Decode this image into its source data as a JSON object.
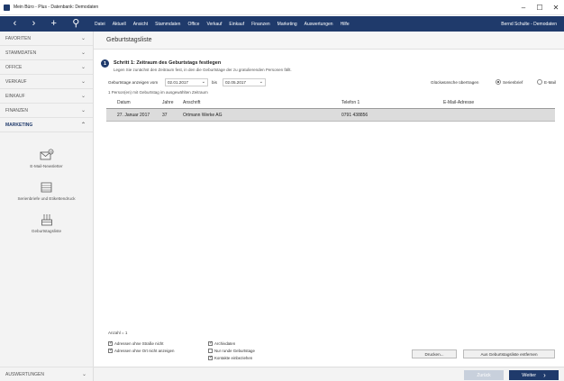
{
  "window": {
    "title": "Mein Büro - Plus - Datenbank: Demodaten",
    "min": "–",
    "max": "☐",
    "close": "✕"
  },
  "nav": {
    "back": "‹",
    "forward": "›",
    "add": "+",
    "search": "⚲"
  },
  "menu": [
    "Datei",
    "Aktuell",
    "Ansicht",
    "Stammdaten",
    "Office",
    "Verkauf",
    "Einkauf",
    "Finanzen",
    "Marketing",
    "Auswertungen",
    "Hilfe"
  ],
  "user": "Bernd Schulte - Demodaten",
  "sidebar": {
    "items": [
      {
        "label": "FAVORITEN",
        "chev": "⌄"
      },
      {
        "label": "STAMMDATEN",
        "chev": "⌄"
      },
      {
        "label": "OFFICE",
        "chev": "⌄"
      },
      {
        "label": "VERKAUF",
        "chev": "⌄"
      },
      {
        "label": "EINKAUF",
        "chev": "⌄"
      },
      {
        "label": "FINANZEN",
        "chev": "⌄"
      },
      {
        "label": "MARKETING",
        "chev": "⌃"
      }
    ],
    "tools": [
      "E-Mail-Newsletter",
      "Serienbriefe und Etikettendruck",
      "Geburtstagsliste"
    ],
    "bottom": {
      "label": "AUSWERTUNGEN",
      "chev": "⌄"
    }
  },
  "header": {
    "title": "Geburtstagsliste"
  },
  "step": {
    "num": "1",
    "title": "Schritt 1: Zeitraum des Geburtstags festlegen",
    "desc": "Legen Sie zunächst den Zeitraum fest, in den die Geburtstage der zu gratulierenden Personen fällt."
  },
  "range": {
    "label": "Geburtstage anzeigen vom",
    "from": "02.01.2017",
    "bis": "bis",
    "to": "02.05.2017",
    "found": "1 Person(en) mit Geburtstag im ausgewählten Zeitraum"
  },
  "greet": {
    "label": "Glückwünsche übertragen",
    "opt1": "Serienbrief",
    "opt2": "E-Mail"
  },
  "table": {
    "headers": [
      "Datum",
      "Jahre",
      "Anschrift",
      "Telefon 1",
      "E-Mail-Adresse"
    ],
    "rows": [
      [
        "27. Januar 2017",
        "37",
        "Ortmann Werke AG",
        "0791 438856",
        ""
      ]
    ]
  },
  "count": "Anzahl = 1",
  "options": {
    "cb1": "Adressen ohne Straße nicht",
    "cb2": "Adressen ohne Ort nicht anzeigen",
    "cb3": "Archivdaten",
    "cb4": "Nur runde Geburtstage",
    "cb5": "Kontakte einbeziehen"
  },
  "buttons": {
    "print": "Drucken...",
    "remove": "Aus Geburtstagsliste entfernen",
    "back": "Zurück",
    "next": "Weiter",
    "next_arrow": "›"
  }
}
